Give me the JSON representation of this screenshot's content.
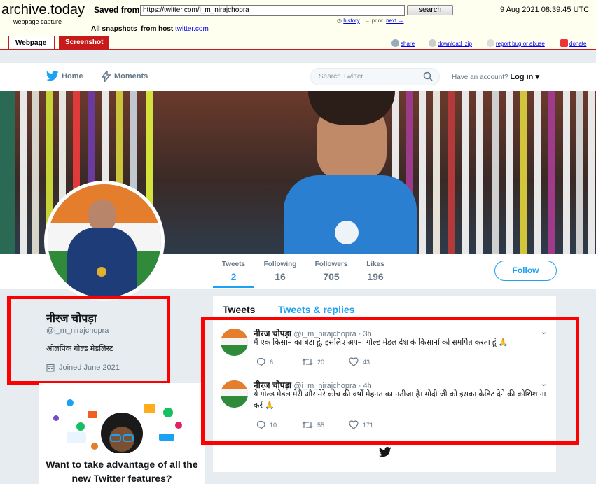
{
  "archive": {
    "logo": "archive.today",
    "logo_sub": "webpage capture",
    "saved_from_label": "Saved from",
    "url": "https://twitter.com/i_m_nirajchopra",
    "search_button": "search",
    "date": "9 Aug 2021 08:39:45 UTC",
    "all_snapshots_label": "All snapshots",
    "from_host_label": "from host",
    "host": "twitter.com",
    "history": "history",
    "prior": "← prior",
    "next": "next →",
    "tabs": {
      "webpage": "Webpage",
      "screenshot": "Screenshot"
    },
    "links": {
      "share": "share",
      "download": "download .zip",
      "report": "report bug or abuse",
      "donate": "donate"
    },
    "accent_color": "#c71a1a"
  },
  "nav": {
    "home": "Home",
    "moments": "Moments",
    "search_placeholder": "Search Twitter",
    "have_account": "Have an account?",
    "login": "Log in"
  },
  "stats": {
    "tweets": {
      "label": "Tweets",
      "value": "2"
    },
    "following": {
      "label": "Following",
      "value": "16"
    },
    "followers": {
      "label": "Followers",
      "value": "705"
    },
    "likes": {
      "label": "Likes",
      "value": "196"
    }
  },
  "follow_button": "Follow",
  "profile": {
    "name": "नीरज चोपड़ा",
    "handle": "@i_m_nirajchopra",
    "bio": "ओलंपिक गोल्ड मेडलिस्ट",
    "joined": "Joined June 2021"
  },
  "promo": {
    "title": "Want to take advantage of all the new Twitter features?"
  },
  "timeline": {
    "tabs": {
      "tweets": "Tweets",
      "replies": "Tweets & replies"
    },
    "tweets": [
      {
        "name": "नीरज चोपड़ा",
        "meta": "@i_m_nirajchopra · 3h",
        "text": "मैं एक किसान का बेटा हूं, इसलिए अपना गोल्ड मेडल देश के किसानों को समर्पित करता हूं 🙏",
        "replies": "6",
        "retweets": "20",
        "likes": "43"
      },
      {
        "name": "नीरज चोपड़ा",
        "meta": "@i_m_nirajchopra · 4h",
        "text": "ये गोल्ड मेडल मेरी और मेरे कोच की वर्षों मेहनत का नतीजा है। मोदी जी को इसका क्रेडिट देने की कोशिश ना करें 🙏",
        "replies": "10",
        "retweets": "55",
        "likes": "171"
      }
    ]
  },
  "colors": {
    "twitter_blue": "#1da1f2",
    "highlight": "#ff0000"
  }
}
